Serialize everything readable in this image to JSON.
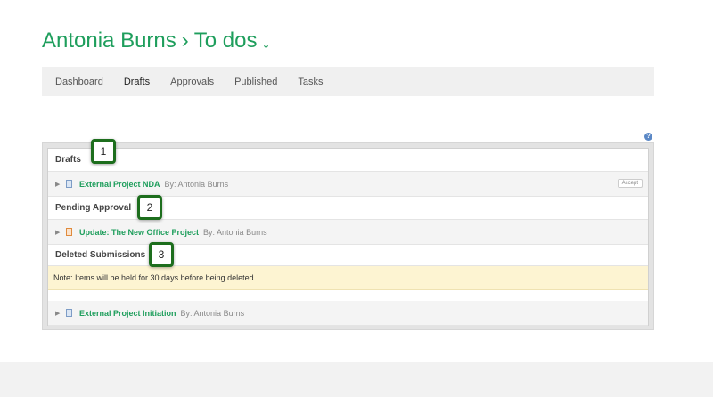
{
  "header": {
    "user": "Antonia Burns",
    "separator": "›",
    "section": "To dos",
    "dropdown_icon": "chevron-down-icon"
  },
  "tabs": [
    {
      "label": "Dashboard"
    },
    {
      "label": "Drafts"
    },
    {
      "label": "Approvals"
    },
    {
      "label": "Published"
    },
    {
      "label": "Tasks"
    }
  ],
  "help": {
    "icon": "help-icon",
    "glyph": "?"
  },
  "sections": {
    "drafts": {
      "title": "Drafts",
      "items": [
        {
          "title": "External Project NDA",
          "by": "By: Antonia Burns",
          "action": "Accept",
          "icon": "document-icon",
          "icon_color": "#7d9cc6"
        }
      ]
    },
    "pending": {
      "title": "Pending Approval",
      "items": [
        {
          "title": "Update: The New Office Project",
          "by": "By: Antonia Burns",
          "icon": "document-icon",
          "icon_color": "#e08a3c"
        }
      ]
    },
    "deleted": {
      "title": "Deleted Submissions",
      "note": "Note: Items will be held for 30 days before being deleted.",
      "items": [
        {
          "title": "External Project Initiation",
          "by": "By: Antonia Burns",
          "icon": "document-icon",
          "icon_color": "#7d9cc6"
        }
      ]
    }
  },
  "callouts": [
    "1",
    "2",
    "3"
  ],
  "colors": {
    "accent": "#1e9e5c",
    "callout_border": "#1d6e1d",
    "note_bg": "#fdf4d2"
  }
}
